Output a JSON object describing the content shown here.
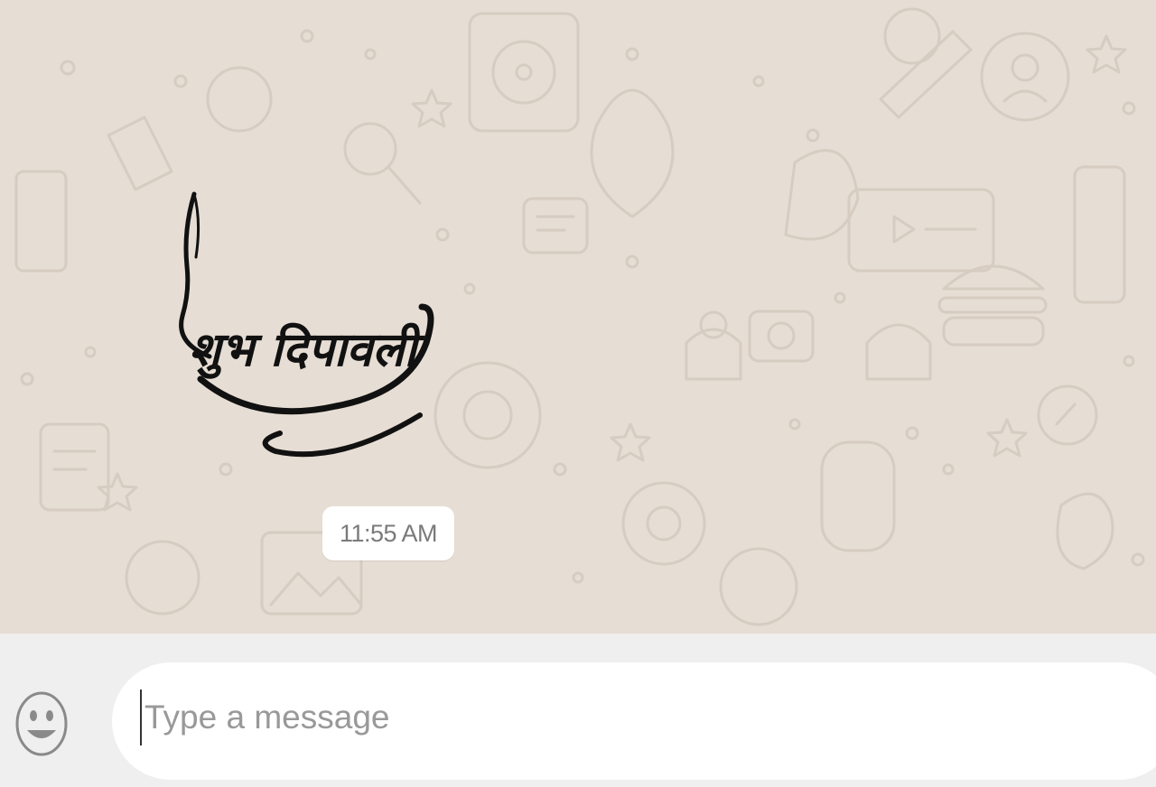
{
  "chat": {
    "sticker_text": "शुभ दिपावली",
    "time": "11:55 AM"
  },
  "composer": {
    "emoji_icon": "smiley-icon",
    "placeholder": "Type a message",
    "value": ""
  },
  "colors": {
    "wallpaper": "#e6ddd4",
    "doodle": "#d9cfc4",
    "bubble": "#ffffff",
    "composer_bg": "#efefef"
  }
}
